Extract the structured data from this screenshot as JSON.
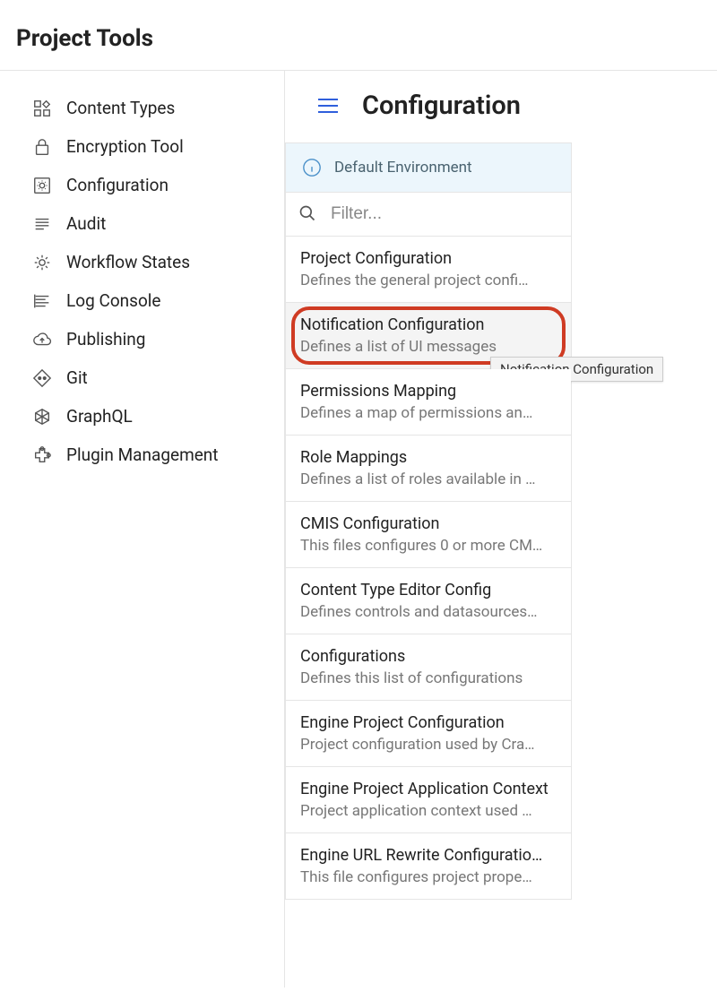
{
  "header": {
    "title": "Project Tools"
  },
  "sidebar": {
    "items": [
      {
        "label": "Content Types",
        "icon": "content-types-icon"
      },
      {
        "label": "Encryption Tool",
        "icon": "lock-icon"
      },
      {
        "label": "Configuration",
        "icon": "gear-box-icon"
      },
      {
        "label": "Audit",
        "icon": "list-icon"
      },
      {
        "label": "Workflow States",
        "icon": "gear-icon"
      },
      {
        "label": "Log Console",
        "icon": "log-icon"
      },
      {
        "label": "Publishing",
        "icon": "cloud-upload-icon"
      },
      {
        "label": "Git",
        "icon": "git-diamond-icon"
      },
      {
        "label": "GraphQL",
        "icon": "graphql-icon"
      },
      {
        "label": "Plugin Management",
        "icon": "extension-icon"
      }
    ]
  },
  "main": {
    "title": "Configuration",
    "environment_label": "Default Environment",
    "filter_placeholder": "Filter...",
    "tooltip": "Notification Configuration",
    "items": [
      {
        "title": "Project Configuration",
        "desc": "Defines the general project confi…"
      },
      {
        "title": "Notification Configuration",
        "desc": "Defines a list of UI messages"
      },
      {
        "title": "Permissions Mapping",
        "desc": "Defines a map of permissions an…"
      },
      {
        "title": "Role Mappings",
        "desc": "Defines a list of roles available in …"
      },
      {
        "title": "CMIS Configuration",
        "desc": "This files configures 0 or more CM…"
      },
      {
        "title": "Content Type Editor Config",
        "desc": "Defines controls and datasources…"
      },
      {
        "title": "Configurations",
        "desc": "Defines this list of configurations"
      },
      {
        "title": "Engine Project Configuration",
        "desc": "Project configuration used by Cra…"
      },
      {
        "title": "Engine Project Application Context",
        "desc": "Project application context used …"
      },
      {
        "title": "Engine URL Rewrite Configuratio…",
        "desc": "This file configures project prope…"
      }
    ],
    "hovered_index": 1,
    "highlighted_index": 1
  }
}
